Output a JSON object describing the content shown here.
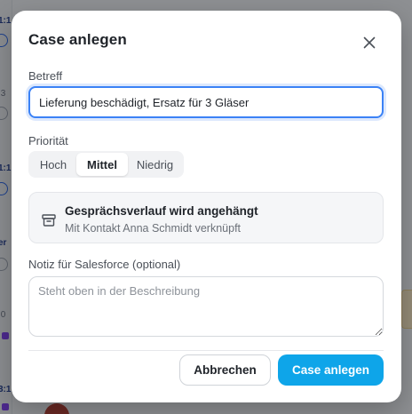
{
  "modal": {
    "title": "Case anlegen",
    "subject_label": "Betreff",
    "subject_value": "Lieferung beschädigt, Ersatz für 3 Gläser",
    "priority_label": "Priorität",
    "priority_options": [
      "Hoch",
      "Mittel",
      "Niedrig"
    ],
    "priority_selected": "Mittel",
    "info": {
      "title": "Gesprächsverlauf wird angehängt",
      "subtitle": "Mit Kontakt Anna Schmidt verknüpft"
    },
    "note_label": "Notiz für Salesforce (optional)",
    "note_placeholder": "Steht oben in der Beschreibung",
    "note_value": "",
    "cancel_label": "Abbrechen",
    "submit_label": "Case anlegen"
  },
  "colors": {
    "primary": "#0ea5e9",
    "focus": "#3b82f6",
    "text": "#1f2329",
    "muted": "#6b7078"
  },
  "icons": {
    "close": "close-icon",
    "info": "archive-box-icon"
  }
}
